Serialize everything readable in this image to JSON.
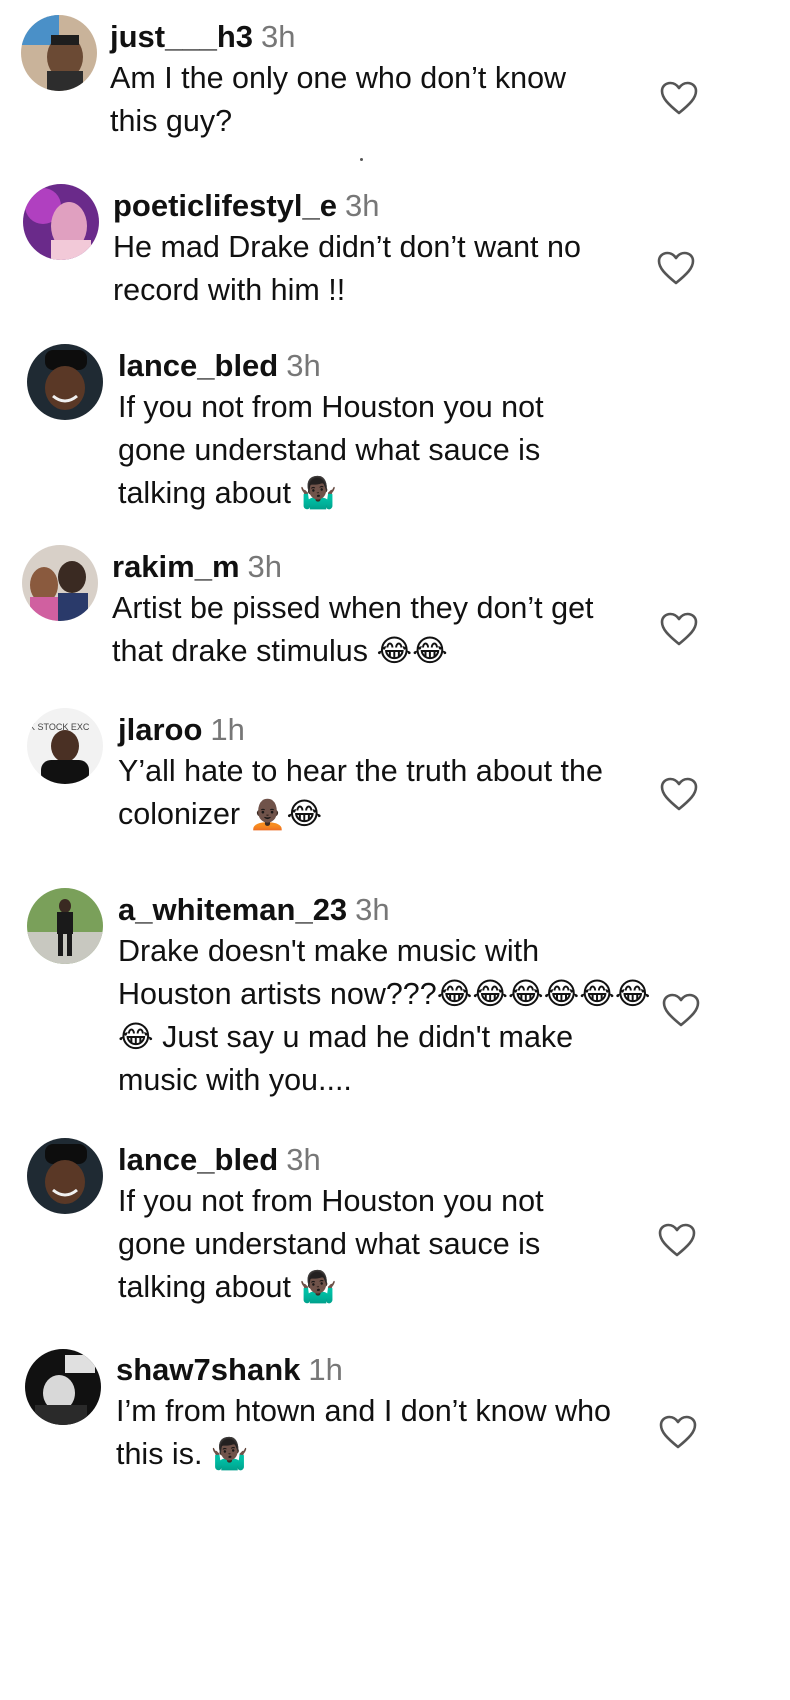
{
  "comments": [
    {
      "username": "just___h3",
      "time": "3h",
      "text": "Am I the only one who don’t know\nthis guy?",
      "like_icon": "heart-outline-icon"
    },
    {
      "username": "poeticlifestyl_e",
      "time": "3h",
      "text": "He mad Drake didn’t don’t want no\nrecord with him !!",
      "like_icon": "heart-outline-icon"
    },
    {
      "username": "lance_bled",
      "time": "3h",
      "text": "If you not from Houston you not\ngone understand what sauce is\ntalking about 🤷🏿‍♂️",
      "like_icon": ""
    },
    {
      "username": "rakim_m",
      "time": "3h",
      "text": "Artist be pissed when they don’t get\nthat drake stimulus 😂😂",
      "like_icon": "heart-outline-icon"
    },
    {
      "username": "jlaroo",
      "time": "1h",
      "text": "Y’all hate to hear the truth about the\ncolonizer 🧑🏿‍🦲😂",
      "like_icon": "heart-outline-icon"
    },
    {
      "username": "a_whiteman_23",
      "time": "3h",
      "text": "Drake doesn't make music with\nHouston artists now???😂😂😂😂😂😂\n😂 Just say u mad he didn't make\nmusic with you....",
      "like_icon": "heart-outline-icon"
    },
    {
      "username": "lance_bled",
      "time": "3h",
      "text": "If you not from Houston you not\ngone understand what sauce is\ntalking about 🤷🏿‍♂️",
      "like_icon": "heart-outline-icon"
    },
    {
      "username": "shaw7shank",
      "time": "1h",
      "text": "I’m from htown and I don’t know who\nthis is. 🤷🏿‍♂️",
      "like_icon": "heart-outline-icon"
    }
  ],
  "avatar_labels": {
    "jlaroo": "K STOCK EXC"
  },
  "colors": {
    "username": "#111111",
    "timestamp": "#777777",
    "body": "#111111",
    "heart": "#555555"
  }
}
